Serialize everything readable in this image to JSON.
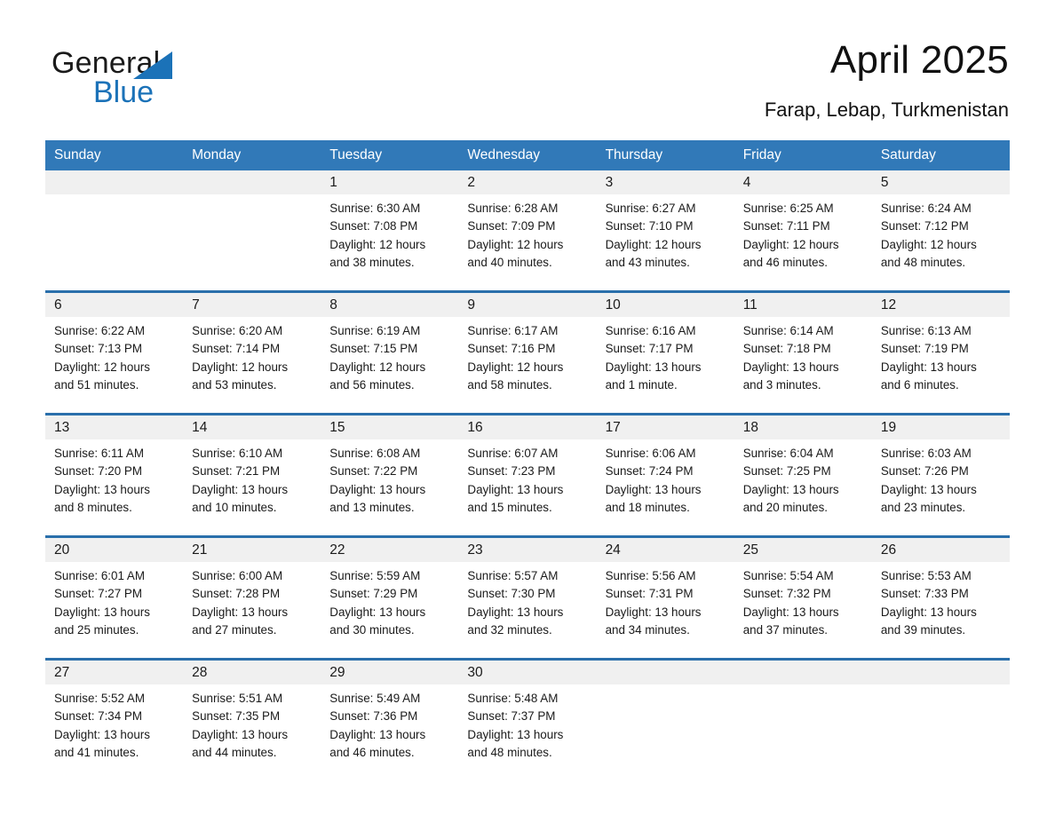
{
  "brand": {
    "name_part1": "General",
    "name_part2": "Blue",
    "triangle_color": "#1b72b8"
  },
  "header": {
    "month_title": "April 2025",
    "location": "Farap, Lebap, Turkmenistan"
  },
  "colors": {
    "header_blue": "#3179b8",
    "week_separator": "#2a6fab",
    "daynum_band": "#f0f0f0",
    "text": "#1a1a1a"
  },
  "weekday_headers": [
    "Sunday",
    "Monday",
    "Tuesday",
    "Wednesday",
    "Thursday",
    "Friday",
    "Saturday"
  ],
  "weeks": [
    [
      {
        "day": "",
        "detail": ""
      },
      {
        "day": "",
        "detail": ""
      },
      {
        "day": "1",
        "detail": "Sunrise: 6:30 AM\nSunset: 7:08 PM\nDaylight: 12 hours\nand 38 minutes."
      },
      {
        "day": "2",
        "detail": "Sunrise: 6:28 AM\nSunset: 7:09 PM\nDaylight: 12 hours\nand 40 minutes."
      },
      {
        "day": "3",
        "detail": "Sunrise: 6:27 AM\nSunset: 7:10 PM\nDaylight: 12 hours\nand 43 minutes."
      },
      {
        "day": "4",
        "detail": "Sunrise: 6:25 AM\nSunset: 7:11 PM\nDaylight: 12 hours\nand 46 minutes."
      },
      {
        "day": "5",
        "detail": "Sunrise: 6:24 AM\nSunset: 7:12 PM\nDaylight: 12 hours\nand 48 minutes."
      }
    ],
    [
      {
        "day": "6",
        "detail": "Sunrise: 6:22 AM\nSunset: 7:13 PM\nDaylight: 12 hours\nand 51 minutes."
      },
      {
        "day": "7",
        "detail": "Sunrise: 6:20 AM\nSunset: 7:14 PM\nDaylight: 12 hours\nand 53 minutes."
      },
      {
        "day": "8",
        "detail": "Sunrise: 6:19 AM\nSunset: 7:15 PM\nDaylight: 12 hours\nand 56 minutes."
      },
      {
        "day": "9",
        "detail": "Sunrise: 6:17 AM\nSunset: 7:16 PM\nDaylight: 12 hours\nand 58 minutes."
      },
      {
        "day": "10",
        "detail": "Sunrise: 6:16 AM\nSunset: 7:17 PM\nDaylight: 13 hours\nand 1 minute."
      },
      {
        "day": "11",
        "detail": "Sunrise: 6:14 AM\nSunset: 7:18 PM\nDaylight: 13 hours\nand 3 minutes."
      },
      {
        "day": "12",
        "detail": "Sunrise: 6:13 AM\nSunset: 7:19 PM\nDaylight: 13 hours\nand 6 minutes."
      }
    ],
    [
      {
        "day": "13",
        "detail": "Sunrise: 6:11 AM\nSunset: 7:20 PM\nDaylight: 13 hours\nand 8 minutes."
      },
      {
        "day": "14",
        "detail": "Sunrise: 6:10 AM\nSunset: 7:21 PM\nDaylight: 13 hours\nand 10 minutes."
      },
      {
        "day": "15",
        "detail": "Sunrise: 6:08 AM\nSunset: 7:22 PM\nDaylight: 13 hours\nand 13 minutes."
      },
      {
        "day": "16",
        "detail": "Sunrise: 6:07 AM\nSunset: 7:23 PM\nDaylight: 13 hours\nand 15 minutes."
      },
      {
        "day": "17",
        "detail": "Sunrise: 6:06 AM\nSunset: 7:24 PM\nDaylight: 13 hours\nand 18 minutes."
      },
      {
        "day": "18",
        "detail": "Sunrise: 6:04 AM\nSunset: 7:25 PM\nDaylight: 13 hours\nand 20 minutes."
      },
      {
        "day": "19",
        "detail": "Sunrise: 6:03 AM\nSunset: 7:26 PM\nDaylight: 13 hours\nand 23 minutes."
      }
    ],
    [
      {
        "day": "20",
        "detail": "Sunrise: 6:01 AM\nSunset: 7:27 PM\nDaylight: 13 hours\nand 25 minutes."
      },
      {
        "day": "21",
        "detail": "Sunrise: 6:00 AM\nSunset: 7:28 PM\nDaylight: 13 hours\nand 27 minutes."
      },
      {
        "day": "22",
        "detail": "Sunrise: 5:59 AM\nSunset: 7:29 PM\nDaylight: 13 hours\nand 30 minutes."
      },
      {
        "day": "23",
        "detail": "Sunrise: 5:57 AM\nSunset: 7:30 PM\nDaylight: 13 hours\nand 32 minutes."
      },
      {
        "day": "24",
        "detail": "Sunrise: 5:56 AM\nSunset: 7:31 PM\nDaylight: 13 hours\nand 34 minutes."
      },
      {
        "day": "25",
        "detail": "Sunrise: 5:54 AM\nSunset: 7:32 PM\nDaylight: 13 hours\nand 37 minutes."
      },
      {
        "day": "26",
        "detail": "Sunrise: 5:53 AM\nSunset: 7:33 PM\nDaylight: 13 hours\nand 39 minutes."
      }
    ],
    [
      {
        "day": "27",
        "detail": "Sunrise: 5:52 AM\nSunset: 7:34 PM\nDaylight: 13 hours\nand 41 minutes."
      },
      {
        "day": "28",
        "detail": "Sunrise: 5:51 AM\nSunset: 7:35 PM\nDaylight: 13 hours\nand 44 minutes."
      },
      {
        "day": "29",
        "detail": "Sunrise: 5:49 AM\nSunset: 7:36 PM\nDaylight: 13 hours\nand 46 minutes."
      },
      {
        "day": "30",
        "detail": "Sunrise: 5:48 AM\nSunset: 7:37 PM\nDaylight: 13 hours\nand 48 minutes."
      },
      {
        "day": "",
        "detail": ""
      },
      {
        "day": "",
        "detail": ""
      },
      {
        "day": "",
        "detail": ""
      }
    ]
  ]
}
